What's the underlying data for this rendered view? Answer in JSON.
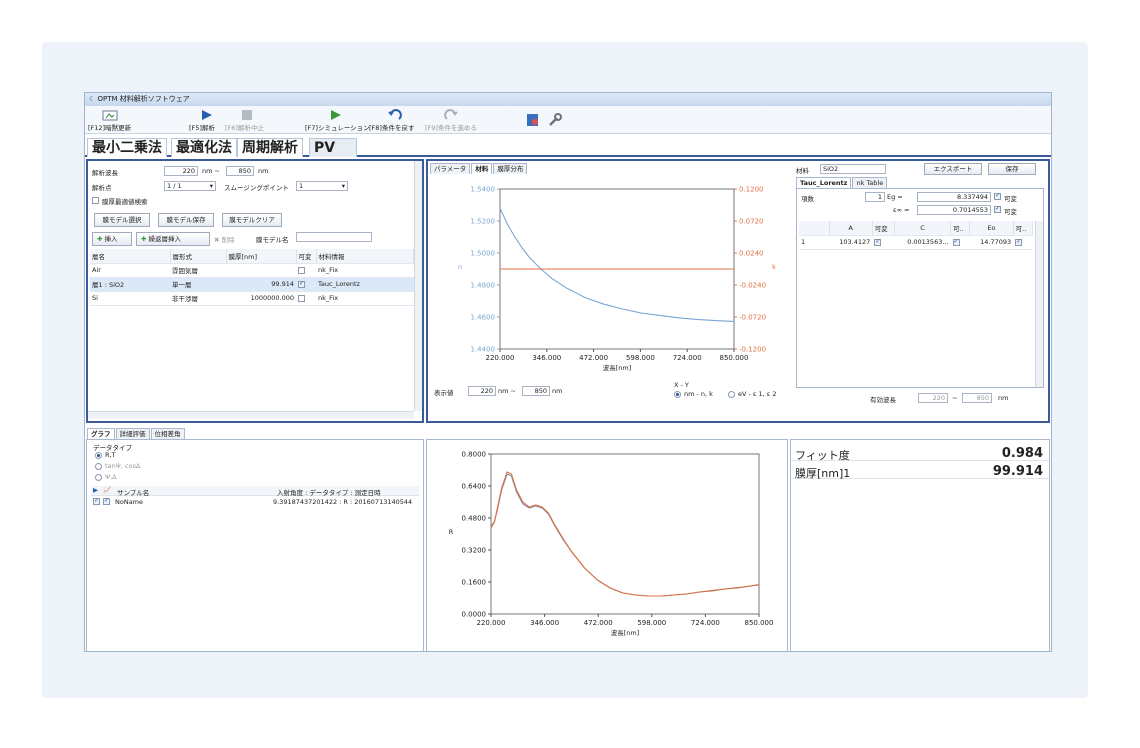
{
  "app": {
    "title": "OPTM 材料解析ソフトウェア"
  },
  "toolbar": {
    "update": "[F12]暗黙更新",
    "f5": "[F5]解析",
    "f6": "[F6]解析中止",
    "f7": "[F7]シミュレーション",
    "f8": "[F8]条件を戻す",
    "f9": "[F9]条件を進める"
  },
  "method_tabs": [
    "最小二乗法",
    "最適化法",
    "周期解析",
    "PV"
  ],
  "left": {
    "wl_label": "解析波長",
    "wl_from": "220",
    "wl_unit1": "nm ~",
    "wl_to": "850",
    "wl_unit2": "nm",
    "pts_label": "解析点",
    "pts_value": "1 / 1",
    "smooth_label": "スムージングポイント",
    "smooth_value": "1",
    "opt_label": "膜厚最適値検索",
    "btn_select": "膜モデル選択",
    "btn_save": "膜モデル保存",
    "btn_clear": "膜モデルクリア",
    "btn_insert": "挿入",
    "btn_multi": "繰返層挿入",
    "btn_delete": "削除",
    "model_name_label": "膜モデル名",
    "headers": [
      "層名",
      "層形式",
      "膜厚[nm]",
      "可変",
      "材料情報"
    ],
    "rows": [
      {
        "name": "Air",
        "type": "雰囲気層",
        "thick": "",
        "var": false,
        "mat": "nk_Fix"
      },
      {
        "name": "層1 : SiO2",
        "type": "単一層",
        "thick": "99.914",
        "var": true,
        "mat": "Tauc_Lorentz"
      },
      {
        "name": "Si",
        "type": "非干渉層",
        "thick": "1000000.000",
        "var": false,
        "mat": "nk_Fix"
      }
    ]
  },
  "mid": {
    "tabs": [
      "パラメータ",
      "材料",
      "膜厚分布"
    ],
    "xlabel": "波長[nm]",
    "ylabel_left": "n",
    "ylabel_right": "k",
    "disp_label": "表示値",
    "disp_from": "220",
    "disp_unit1": "nm ~",
    "disp_to": "850",
    "disp_unit2": "nm",
    "xy_label": "X - Y",
    "radio1": "nm - n, k",
    "radio2": "eV - ε 1, ε 2"
  },
  "right": {
    "mat_label": "材料",
    "mat_value": "SiO2",
    "export": "エクスポート",
    "save": "保存",
    "tabs": [
      "Tauc_Lorentz",
      "nk Table"
    ],
    "terms_label": "項数",
    "terms_value": "1",
    "eg_label": "Eg =",
    "eg_value": "8.337494",
    "eg_var": "可変",
    "einf_label": "ε∞ =",
    "einf_value": "0.7014553",
    "einf_var": "可変",
    "headers": [
      "",
      "A",
      "可変",
      "C",
      "可..",
      "Eo",
      "可.."
    ],
    "row": [
      "1",
      "103.4127",
      "",
      "0.0013563...",
      "",
      "14.77093",
      ""
    ],
    "eff_label": "有効波長",
    "eff_from": "220",
    "eff_to": "850",
    "eff_unit": "nm"
  },
  "bottom": {
    "tabs": [
      "グラフ",
      "詳細評価",
      "位相差角"
    ],
    "dtype_label": "データタイプ",
    "r1": "R,T",
    "r2": "tanΨ, cosΔ",
    "r3": "Ψ,Δ",
    "col1": "サンプル名",
    "col2": "入射角度 : データタイプ : 測定日時",
    "sample": "NoName",
    "sample_info": "9.39187437201422 : R : 20160713140544",
    "xlabel": "波長[nm]",
    "ylabel": "R",
    "fit_label": "フィット度",
    "fit_value": "0.984",
    "thick_label": "膜厚[nm]1",
    "thick_value": "99.914"
  },
  "colors": {
    "accent": "#3a5a9a",
    "n_line": "#7aa6d6",
    "k_line": "#e07040",
    "meas": "#7c8fa8"
  },
  "chart_data": [
    {
      "type": "line",
      "xlabel": "波長[nm]",
      "ylabel": "n",
      "y2label": "k",
      "xticks": [
        "220.000",
        "346.000",
        "472.000",
        "598.000",
        "724.000",
        "850.000"
      ],
      "xlim": [
        220,
        850
      ],
      "yticks": [
        "1.5400",
        "1.5200",
        "1.5000",
        "1.4800",
        "1.4600",
        "1.4400"
      ],
      "ylim": [
        1.44,
        1.54
      ],
      "y2ticks": [
        "0.1200",
        "0.0720",
        "0.0240",
        "-0.0240",
        "-0.0720",
        "-0.1200"
      ],
      "y2lim": [
        -0.12,
        0.12
      ],
      "series": [
        {
          "x": [
            220,
            240,
            260,
            280,
            300,
            330,
            360,
            400,
            450,
            500,
            550,
            600,
            650,
            700,
            750,
            800,
            850
          ],
          "values": [
            1.528,
            1.518,
            1.51,
            1.503,
            1.497,
            1.49,
            1.484,
            1.478,
            1.472,
            1.468,
            1.465,
            1.4625,
            1.461,
            1.4595,
            1.4585,
            1.4578,
            1.4572
          ]
        },
        {
          "x": [
            220,
            850
          ],
          "values": [
            0,
            0
          ],
          "axis": "right"
        }
      ]
    },
    {
      "type": "line",
      "xlabel": "波長[nm]",
      "ylabel": "R",
      "xticks": [
        "220.000",
        "346.000",
        "472.000",
        "598.000",
        "724.000",
        "850.000"
      ],
      "xlim": [
        220,
        850
      ],
      "yticks": [
        "0.8000",
        "0.6400",
        "0.4800",
        "0.3200",
        "0.1600",
        "0.0000"
      ],
      "ylim": [
        0,
        0.8
      ],
      "series": [
        {
          "x": [
            220,
            228,
            235,
            245,
            258,
            268,
            280,
            295,
            310,
            325,
            340,
            355,
            370,
            390,
            410,
            440,
            470,
            500,
            530,
            560,
            590,
            620,
            650,
            680,
            710,
            740,
            770,
            800,
            830,
            850
          ],
          "values": [
            0.44,
            0.46,
            0.52,
            0.62,
            0.7,
            0.69,
            0.61,
            0.55,
            0.53,
            0.54,
            0.53,
            0.5,
            0.44,
            0.37,
            0.31,
            0.23,
            0.17,
            0.13,
            0.105,
            0.095,
            0.09,
            0.09,
            0.095,
            0.1,
            0.11,
            0.115,
            0.125,
            0.13,
            0.14,
            0.145
          ]
        },
        {
          "x": [
            220,
            228,
            235,
            245,
            258,
            268,
            280,
            295,
            310,
            325,
            340,
            355,
            370,
            390,
            410,
            440,
            470,
            500,
            530,
            560,
            590,
            620,
            650,
            680,
            710,
            740,
            770,
            800,
            830,
            850
          ],
          "values": [
            0.43,
            0.46,
            0.53,
            0.63,
            0.71,
            0.7,
            0.62,
            0.56,
            0.535,
            0.545,
            0.535,
            0.505,
            0.445,
            0.375,
            0.31,
            0.23,
            0.17,
            0.13,
            0.105,
            0.095,
            0.09,
            0.09,
            0.095,
            0.1,
            0.11,
            0.118,
            0.125,
            0.132,
            0.14,
            0.147
          ]
        }
      ]
    }
  ]
}
